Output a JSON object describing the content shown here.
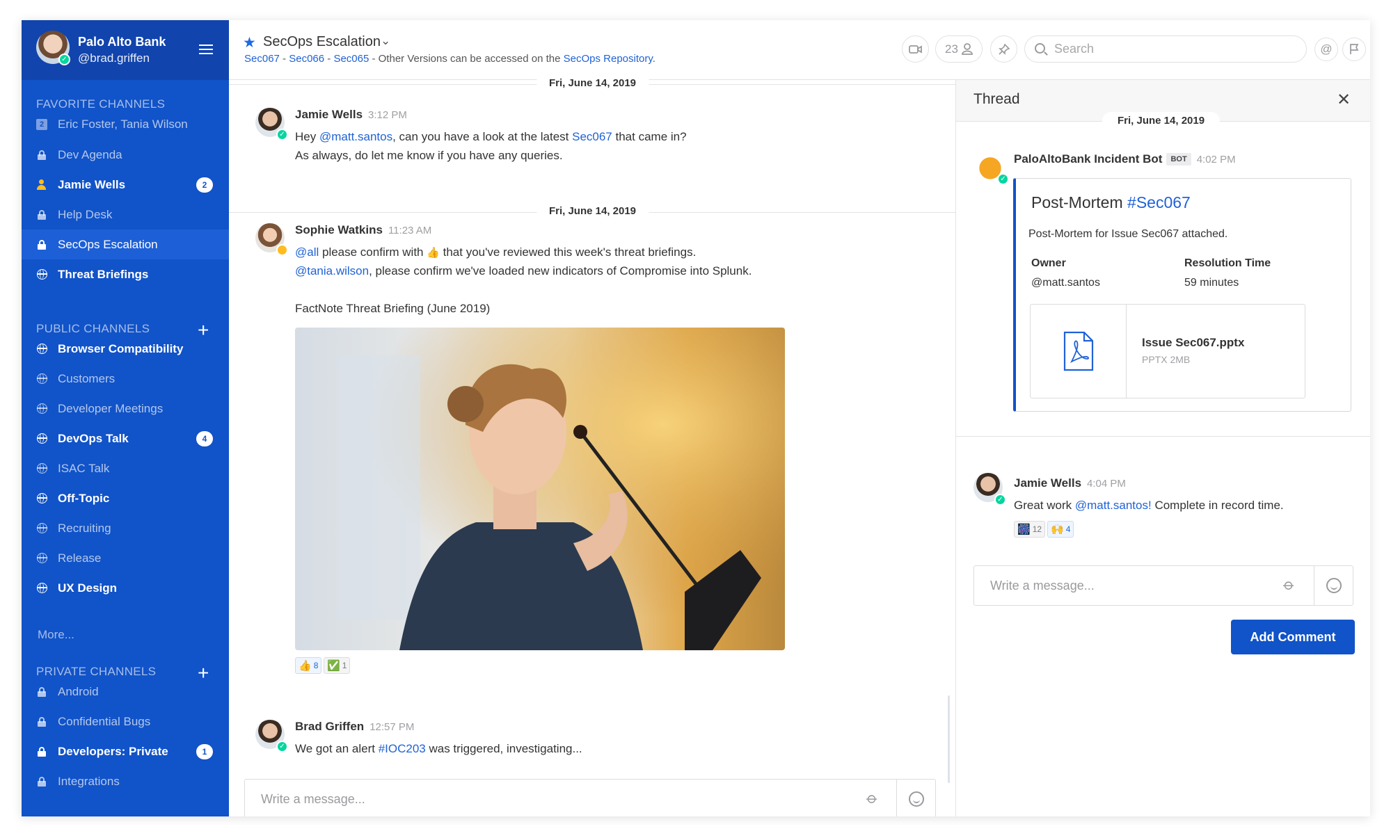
{
  "team": {
    "name": "Palo Alto Bank",
    "username": "@brad.griffen"
  },
  "sidebar": {
    "favorites_title": "FAVORITE CHANNELS",
    "favorites": [
      {
        "label": "Eric Foster, Tania Wilson",
        "icon": "group-dm-icon",
        "icon_text": "2"
      },
      {
        "label": "Dev Agenda",
        "icon": "lock-icon"
      },
      {
        "label": "Jamie Wells",
        "icon": "user-status-icon",
        "badge": "2"
      },
      {
        "label": "Help Desk",
        "icon": "lock-icon"
      },
      {
        "label": "SecOps Escalation",
        "icon": "lock-icon"
      },
      {
        "label": "Threat Briefings",
        "icon": "globe-icon"
      }
    ],
    "public_title": "PUBLIC CHANNELS",
    "public": [
      {
        "label": "Browser Compatibility"
      },
      {
        "label": "Customers"
      },
      {
        "label": "Developer Meetings"
      },
      {
        "label": "DevOps Talk",
        "badge": "4"
      },
      {
        "label": "ISAC Talk"
      },
      {
        "label": "Off-Topic"
      },
      {
        "label": "Recruiting"
      },
      {
        "label": "Release"
      },
      {
        "label": "UX Design"
      }
    ],
    "more_label": "More...",
    "private_title": "PRIVATE CHANNELS",
    "private": [
      {
        "label": "Android"
      },
      {
        "label": "Confidential Bugs"
      },
      {
        "label": "Developers: Private",
        "badge": "1"
      },
      {
        "label": "Integrations"
      }
    ]
  },
  "header": {
    "channel_name": "SecOps Escalation",
    "purpose": {
      "link1": "Sec067",
      "sep1": " - ",
      "link2": "Sec066",
      "sep2": " - ",
      "link3": "Sec065",
      "text": " - Other Versions can be accessed on the ",
      "link4": "SecOps Repository",
      "end": "."
    },
    "member_count": "23",
    "search_placeholder": "Search"
  },
  "posts": {
    "date1": "Fri, June 14, 2019",
    "p1": {
      "author": "Jamie Wells",
      "time": "3:12 PM",
      "l1a": "Hey ",
      "l1_mention": "@matt.santos",
      "l1b": ", can you have a look at the latest ",
      "l1_link": "Sec067",
      "l1c": " that came in?",
      "l2": "As always, do let me know if you have any queries."
    },
    "date2": "Fri, June 14, 2019",
    "p2": {
      "author": "Sophie Watkins",
      "time": "11:23 AM",
      "l1_mention": "@all",
      "l1a": " please confirm with ",
      "l1_emoji": "👍",
      "l1b": " that you've reviewed this week's threat briefings.",
      "l2_mention": "@tania.wilson",
      "l2a": ", please confirm we've loaded new indicators of Compromise into Splunk.",
      "link": "FactNote Threat Briefing (June 2019)",
      "reactions": [
        {
          "emoji": "👍",
          "count": "8"
        },
        {
          "emoji": "✅",
          "count": "1"
        }
      ]
    },
    "p3": {
      "author": "Brad Griffen",
      "time": "12:57 PM",
      "l1a": "We got an alert ",
      "l1_link": "#IOC203",
      "l1b": " was triggered, investigating..."
    }
  },
  "composer": {
    "placeholder": "Write a message..."
  },
  "thread": {
    "title": "Thread",
    "date": "Fri, June 14, 2019",
    "bot": {
      "name": "PaloAltoBank Incident Bot",
      "tag": "BOT",
      "time": "4:02 PM"
    },
    "attachment": {
      "title_a": "Post-Mortem ",
      "title_link": "#Sec067",
      "text": "Post-Mortem for Issue Sec067 attached.",
      "owner_label": "Owner",
      "owner_value": "@matt.santos",
      "resolution_label": "Resolution Time",
      "resolution_value": "59 minutes",
      "file_name": "Issue Sec067.pptx",
      "file_meta": "PPTX 2MB"
    },
    "reply": {
      "author": "Jamie Wells",
      "time": "4:04 PM",
      "text_a": "Great work ",
      "mention": "@matt.santos!",
      "text_b": " Complete in record time.",
      "reactions": [
        {
          "emoji": "🎆",
          "count": "12"
        },
        {
          "emoji": "🙌",
          "count": "4"
        }
      ]
    },
    "composer_placeholder": "Write a message...",
    "add_comment": "Add Comment"
  },
  "colors": {
    "sidebar": "#1153c8",
    "sidebar_header": "#1144ad",
    "accent": "#1f62d6",
    "online": "#06d6a0",
    "away": "#ffbc1f"
  }
}
